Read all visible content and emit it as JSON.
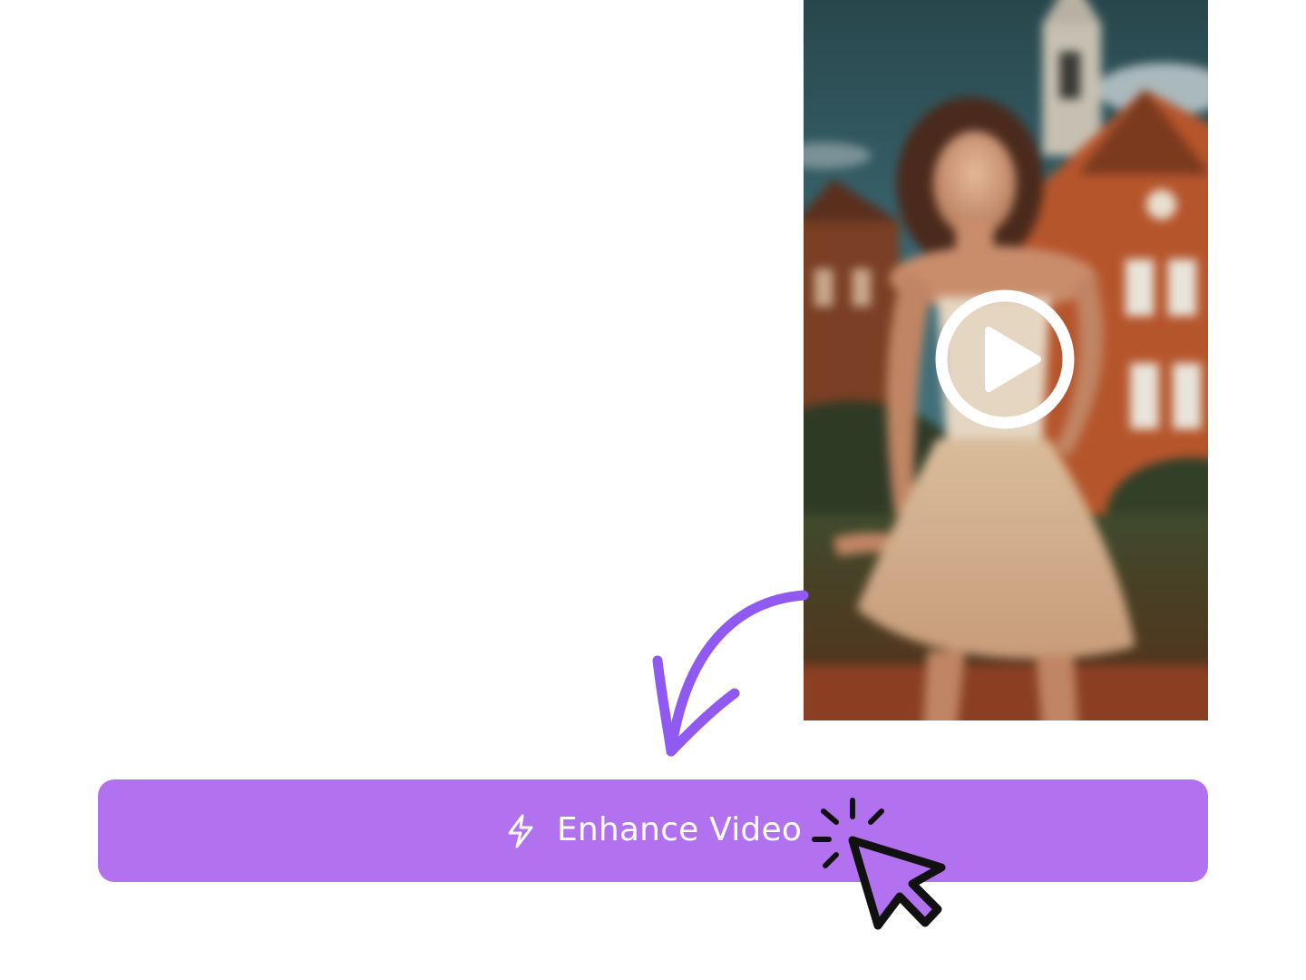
{
  "theme": {
    "accent": "#b272f0",
    "arrow_color": "#8f59f2",
    "button_text_color": "#ffffff",
    "cursor_color": "#111111",
    "background": "#ffffff"
  },
  "video": {
    "thumbnail": "blurred-portrait-thumbnail",
    "play_icon": "play-circle-icon"
  },
  "annotation": {
    "arrow_icon": "curved-arrow-icon"
  },
  "cta": {
    "icon": "lightning-bolt-icon",
    "label": "Enhance Video",
    "cursor_icon": "click-cursor-icon"
  }
}
